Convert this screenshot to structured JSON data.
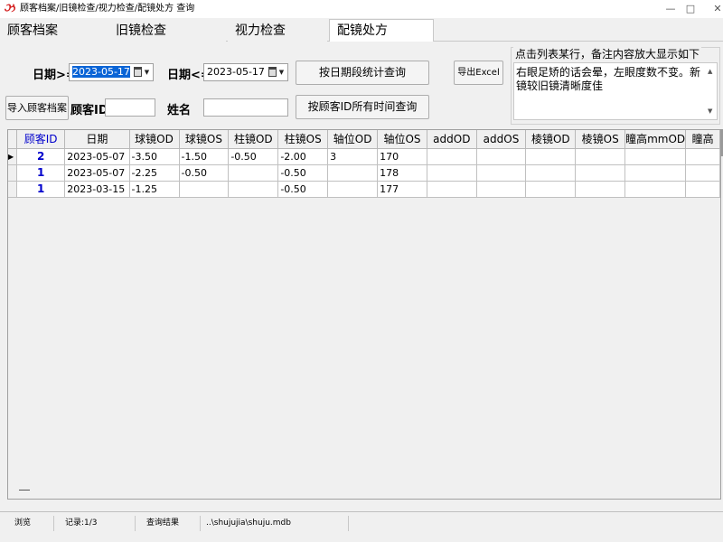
{
  "window": {
    "title": "顾客档案/旧镜检查/视力检查/配镜处方  查询",
    "minimize": "—",
    "maximize": "□",
    "close": "✕"
  },
  "tabs": [
    {
      "label": "顾客档案"
    },
    {
      "label": "旧镜检查"
    },
    {
      "label": "视力检查"
    },
    {
      "label": "配镜处方"
    }
  ],
  "filters": {
    "date_from_label": "日期>=",
    "date_from_value": "2023-05-17",
    "date_to_label": "日期<=",
    "date_to_value": "2023-05-17",
    "query_by_date_button": "按日期段统计查询",
    "export_button": "导出Excel",
    "import_button": "导入顾客档案",
    "customer_id_label": "顾客ID",
    "customer_id_value": "",
    "name_label": "姓名",
    "name_value": "",
    "query_by_id_button": "按顾客ID所有时间查询"
  },
  "memo": {
    "title": "点击列表某行，备注内容放大显示如下",
    "text": "右眼足矫的话会晕，左眼度数不变。新镜较旧镜清晰度佳"
  },
  "table": {
    "columns": [
      "顾客ID",
      "日期",
      "球镜OD",
      "球镜OS",
      "柱镜OD",
      "柱镜OS",
      "轴位OD",
      "轴位OS",
      "addOD",
      "addOS",
      "棱镜OD",
      "棱镜OS",
      "瞳高mmOD",
      "瞳高"
    ],
    "rows": [
      [
        "2",
        "2023-05-07",
        "-3.50",
        "-1.50",
        "-0.50",
        "-2.00",
        "3",
        "170",
        "",
        "",
        "",
        "",
        "",
        ""
      ],
      [
        "1",
        "2023-05-07",
        "-2.25",
        "-0.50",
        "",
        "-0.50",
        "",
        "178",
        "",
        "",
        "",
        "",
        "",
        ""
      ],
      [
        "1",
        "2023-03-15",
        "-1.25",
        "",
        "",
        "-0.50",
        "",
        "177",
        "",
        "",
        "",
        "",
        "",
        ""
      ]
    ],
    "current_row_marker": "▶"
  },
  "status": {
    "mode": "浏览",
    "record": "记录:1/3",
    "state": "查询结果",
    "path": "..\\shujujia\\shuju.mdb"
  }
}
